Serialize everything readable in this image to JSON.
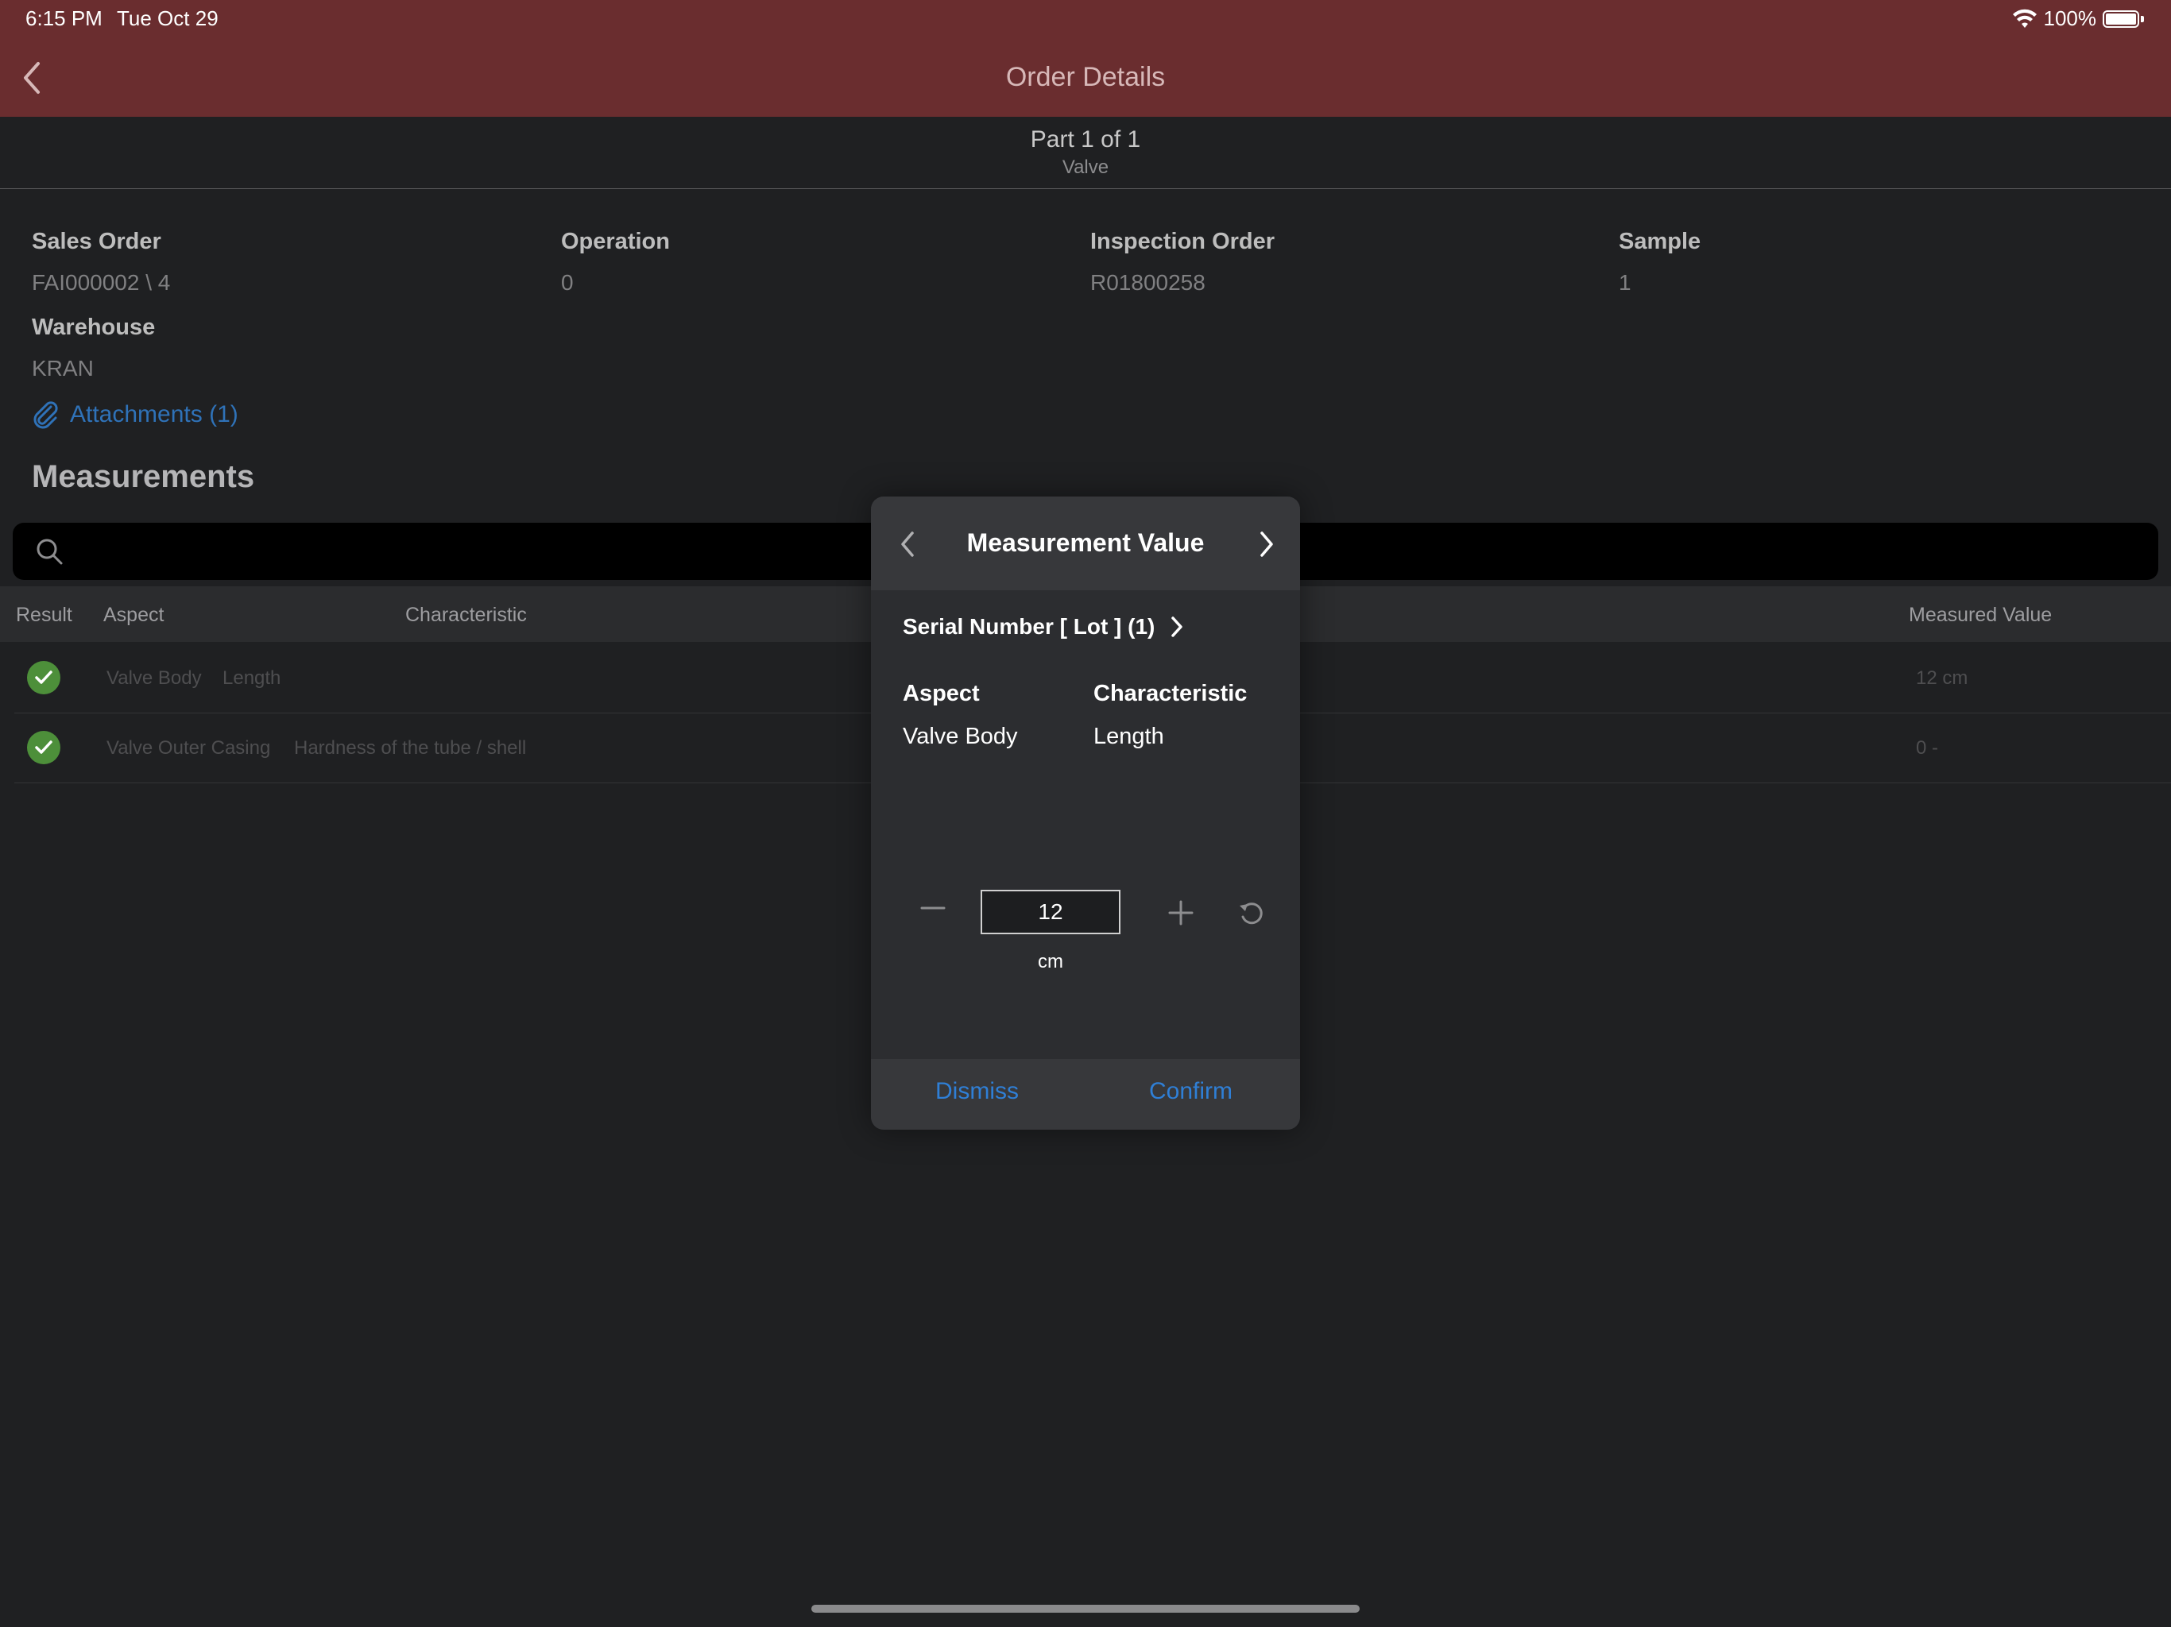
{
  "status_bar": {
    "time": "6:15 PM",
    "date": "Tue Oct 29",
    "battery": "100%"
  },
  "nav": {
    "title": "Order Details"
  },
  "part": {
    "title": "Part 1 of 1",
    "subtitle": "Valve"
  },
  "info": {
    "sales_order": {
      "label": "Sales Order",
      "value": "FAI000002 \\ 4"
    },
    "operation": {
      "label": "Operation",
      "value": "0"
    },
    "inspection_order": {
      "label": "Inspection Order",
      "value": "R01800258"
    },
    "sample": {
      "label": "Sample",
      "value": "1"
    },
    "warehouse": {
      "label": "Warehouse",
      "value": "KRAN"
    }
  },
  "attachments_label": "Attachments (1)",
  "measurements_title": "Measurements",
  "search": {
    "placeholder": ""
  },
  "table": {
    "headers": {
      "result": "Result",
      "aspect": "Aspect",
      "characteristic": "Characteristic",
      "measured_value": "Measured Value"
    },
    "rows": [
      {
        "aspect": "Valve Body",
        "characteristic": "Length",
        "measured_value": "12 cm",
        "result": "pass"
      },
      {
        "aspect": "Valve Outer Casing",
        "characteristic": "Hardness of the tube / shell",
        "measured_value": "0 -",
        "result": "pass"
      }
    ]
  },
  "modal": {
    "title": "Measurement Value",
    "serial": "Serial Number [ Lot ] (1)",
    "aspect_label": "Aspect",
    "aspect_value": "Valve Body",
    "characteristic_label": "Characteristic",
    "characteristic_value": "Length",
    "value": "12",
    "unit": "cm",
    "dismiss": "Dismiss",
    "confirm": "Confirm"
  },
  "colors": {
    "nav_bar": "#6a2d2f",
    "accent": "#2f7fd6",
    "pass": "#4d8f3a",
    "background": "#1f2022"
  }
}
